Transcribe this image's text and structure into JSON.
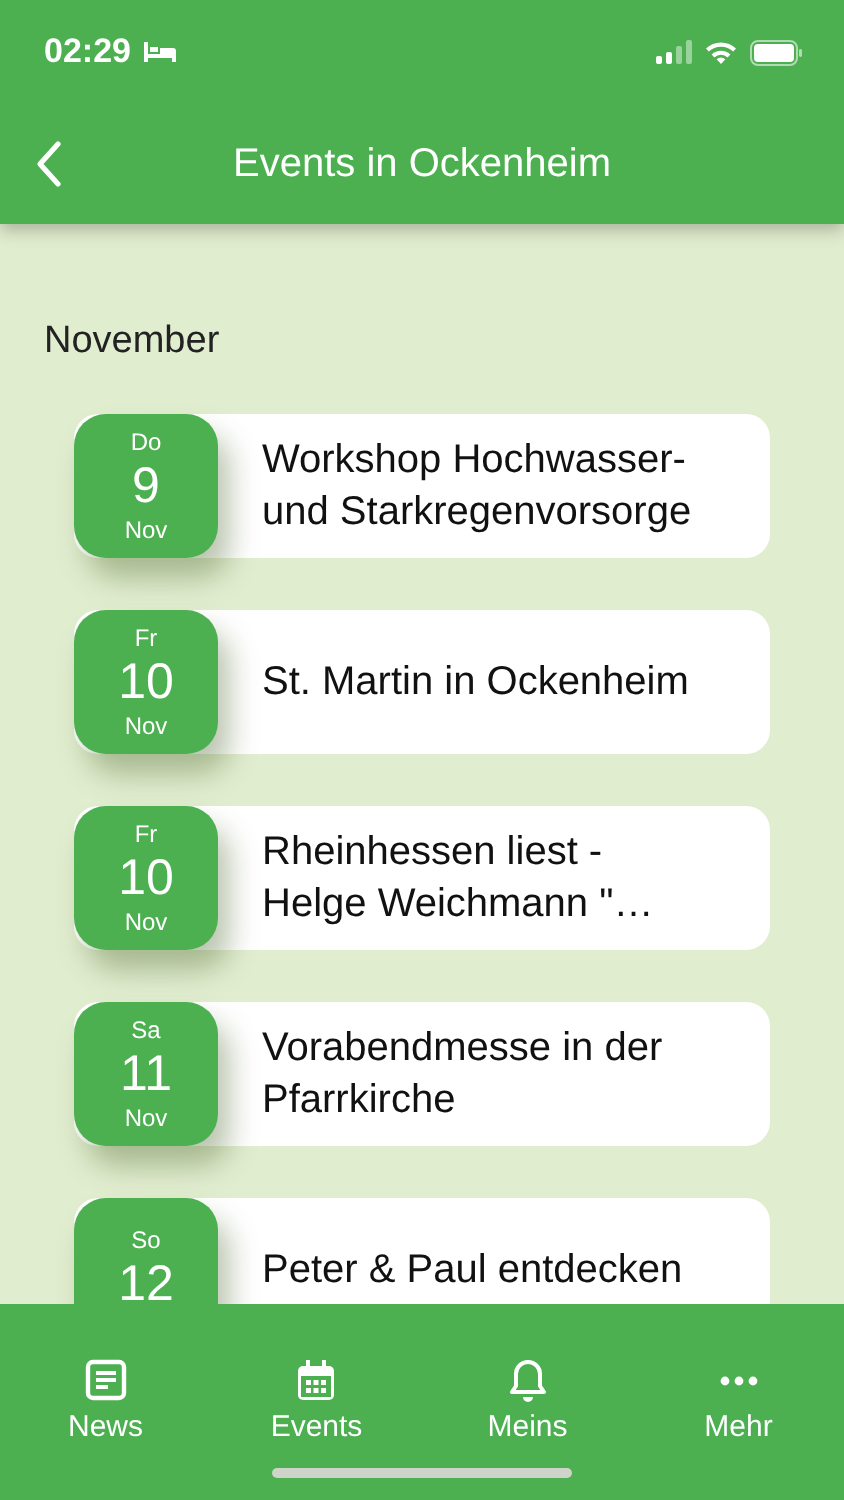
{
  "status_bar": {
    "time": "02:29"
  },
  "header": {
    "title": "Events in Ockenheim"
  },
  "section": {
    "title": "November"
  },
  "events": [
    {
      "weekday": "Do",
      "day": "9",
      "month": "Nov",
      "title": "Workshop Hochwasser- und Starkregenvorsorge"
    },
    {
      "weekday": "Fr",
      "day": "10",
      "month": "Nov",
      "title": "St. Martin in Ockenheim"
    },
    {
      "weekday": "Fr",
      "day": "10",
      "month": "Nov",
      "title": "Rheinhessen liest - Helge Weichmann \"…"
    },
    {
      "weekday": "Sa",
      "day": "11",
      "month": "Nov",
      "title": "Vorabendmesse in der Pfarrkirche"
    },
    {
      "weekday": "So",
      "day": "12",
      "title": "Peter & Paul entdecken"
    }
  ],
  "tab_bar": [
    {
      "kind": "news",
      "label": "News"
    },
    {
      "kind": "events",
      "label": "Events"
    },
    {
      "kind": "mine",
      "label": "Meins"
    },
    {
      "kind": "more",
      "label": "Mehr"
    }
  ]
}
